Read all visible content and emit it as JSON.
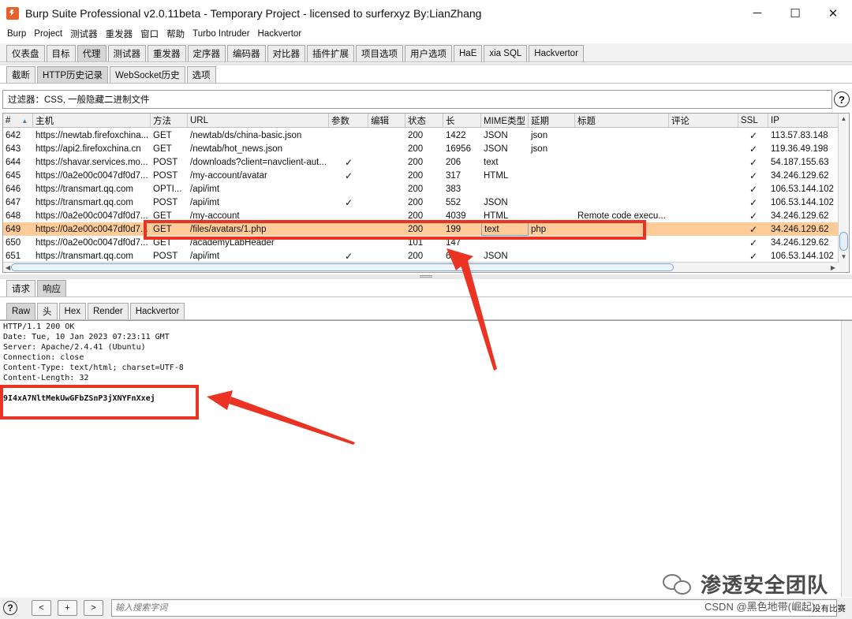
{
  "window": {
    "title": "Burp Suite Professional v2.0.11beta - Temporary Project - licensed to surferxyz By:LianZhang",
    "controls": [
      "─",
      "☐",
      "✕"
    ]
  },
  "menubar": [
    "Burp",
    "Project",
    "测试器",
    "重发器",
    "窗口",
    "帮助",
    "Turbo Intruder",
    "Hackvertor"
  ],
  "main_tabs": [
    "仪表盘",
    "目标",
    "代理",
    "测试器",
    "重发器",
    "定序器",
    "编码器",
    "对比器",
    "插件扩展",
    "项目选项",
    "用户选项",
    "HaE",
    "xia SQL",
    "Hackvertor"
  ],
  "proxy_tabs": [
    "截断",
    "HTTP历史记录",
    "WebSocket历史",
    "选项"
  ],
  "filter": {
    "text": "过滤器：CSS, 一般隐藏二进制文件",
    "help": "?"
  },
  "table": {
    "sort_indicator": "▲",
    "columns": [
      "#",
      "主机",
      "方法",
      "URL",
      "参数",
      "编辑",
      "状态",
      "长",
      "MIME类型",
      "延期",
      "标题",
      "评论",
      "SSL",
      "IP"
    ],
    "check_mark": "✓",
    "rows": [
      {
        "id": "642",
        "host": "https://newtab.firefoxchina...",
        "method": "GET",
        "url": "/newtab/ds/china-basic.json",
        "params": "",
        "status": "200",
        "length": "1422",
        "mime": "JSON",
        "ext": "json",
        "title": "",
        "ssl": "✓",
        "ip": "113.57.83.148"
      },
      {
        "id": "643",
        "host": "https://api2.firefoxchina.cn",
        "method": "GET",
        "url": "/newtab/hot_news.json",
        "params": "",
        "status": "200",
        "length": "16956",
        "mime": "JSON",
        "ext": "json",
        "title": "",
        "ssl": "✓",
        "ip": "119.36.49.198"
      },
      {
        "id": "644",
        "host": "https://shavar.services.mo...",
        "method": "POST",
        "url": "/downloads?client=navclient-aut...",
        "params": "✓",
        "status": "200",
        "length": "206",
        "mime": "text",
        "ext": "",
        "title": "",
        "ssl": "✓",
        "ip": "54.187.155.63"
      },
      {
        "id": "645",
        "host": "https://0a2e00c0047df0d7...",
        "method": "POST",
        "url": "/my-account/avatar",
        "params": "✓",
        "status": "200",
        "length": "317",
        "mime": "HTML",
        "ext": "",
        "title": "",
        "ssl": "✓",
        "ip": "34.246.129.62"
      },
      {
        "id": "646",
        "host": "https://transmart.qq.com",
        "method": "OPTI...",
        "url": "/api/imt",
        "params": "",
        "status": "200",
        "length": "383",
        "mime": "",
        "ext": "",
        "title": "",
        "ssl": "✓",
        "ip": "106.53.144.102"
      },
      {
        "id": "647",
        "host": "https://transmart.qq.com",
        "method": "POST",
        "url": "/api/imt",
        "params": "✓",
        "status": "200",
        "length": "552",
        "mime": "JSON",
        "ext": "",
        "title": "",
        "ssl": "✓",
        "ip": "106.53.144.102"
      },
      {
        "id": "648",
        "host": "https://0a2e00c0047df0d7...",
        "method": "GET",
        "url": "/my-account",
        "params": "",
        "status": "200",
        "length": "4039",
        "mime": "HTML",
        "ext": "",
        "title": "Remote code execu...",
        "ssl": "✓",
        "ip": "34.246.129.62"
      },
      {
        "id": "649",
        "host": "https://0a2e00c0047df0d7...",
        "method": "GET",
        "url": "/files/avatars/1.php",
        "params": "",
        "status": "200",
        "length": "199",
        "mime": "text",
        "ext": "php",
        "title": "",
        "ssl": "✓",
        "ip": "34.246.129.62",
        "selected": true
      },
      {
        "id": "650",
        "host": "https://0a2e00c0047df0d7...",
        "method": "GET",
        "url": "/academyLabHeader",
        "params": "",
        "status": "101",
        "length": "147",
        "mime": "",
        "ext": "",
        "title": "",
        "ssl": "✓",
        "ip": "34.246.129.62"
      },
      {
        "id": "651",
        "host": "https://transmart.qq.com",
        "method": "POST",
        "url": "/api/imt",
        "params": "✓",
        "status": "200",
        "length": "650",
        "mime": "JSON",
        "ext": "",
        "title": "",
        "ssl": "✓",
        "ip": "106.53.144.102"
      }
    ]
  },
  "reqres_tabs": [
    "请求",
    "响应"
  ],
  "view_tabs": [
    "Raw",
    "头",
    "Hex",
    "Render",
    "Hackvertor"
  ],
  "response": {
    "headers": [
      "HTTP/1.1 200 OK",
      "Date: Tue, 10 Jan 2023 07:23:11 GMT",
      "Server: Apache/2.4.41 (Ubuntu)",
      "Connection: close",
      "Content-Type: text/html; charset=UTF-8",
      "Content-Length: 32"
    ],
    "body": "9I4xA7NltMekUwGFbZSnP3jXNYFnXxej"
  },
  "bottom": {
    "help": "?",
    "prev": "<",
    "add": "+",
    "next": ">",
    "search_placeholder": "输入搜索字词",
    "match_text": "没有比赛"
  },
  "watermark": {
    "text": "渗透安全团队",
    "csdn": "CSDN @黑色地带(崛起)"
  },
  "colors": {
    "selected_row": "#ffcc99",
    "annotation_red": "#ea3323",
    "burp_orange": "#e8602c"
  }
}
